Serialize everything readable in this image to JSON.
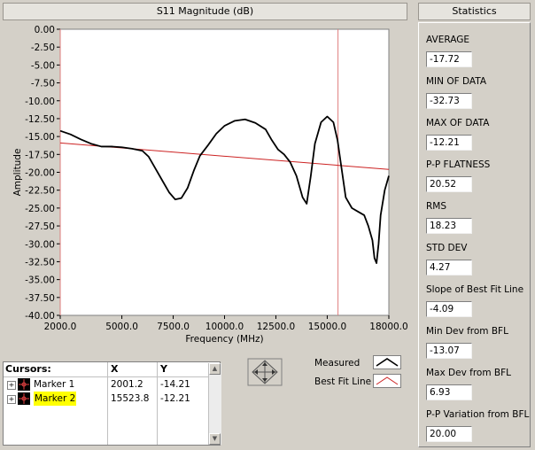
{
  "graph": {
    "title": "S11 Magnitude (dB)",
    "x_label": "Frequency (MHz)",
    "y_label": "Amplitude"
  },
  "stats": {
    "title": "Statistics",
    "items": [
      {
        "label": "AVERAGE",
        "value": "-17.72"
      },
      {
        "label": "MIN OF DATA",
        "value": "-32.73"
      },
      {
        "label": "MAX OF DATA",
        "value": "-12.21"
      },
      {
        "label": "P-P FLATNESS",
        "value": "20.52"
      },
      {
        "label": "RMS",
        "value": "18.23"
      },
      {
        "label": "STD DEV",
        "value": "4.27"
      },
      {
        "label": "Slope of Best Fit Line",
        "value": "-4.09"
      },
      {
        "label": "Min Dev from BFL",
        "value": "-13.07"
      },
      {
        "label": "Max Dev from BFL",
        "value": "6.93"
      },
      {
        "label": "P-P Variation from BFL",
        "value": "20.00"
      }
    ]
  },
  "cursors": {
    "header": "Cursors:",
    "col_x": "X",
    "col_y": "Y",
    "rows": [
      {
        "name": "Marker 1",
        "x": "2001.2",
        "y": "-14.21",
        "highlight": false
      },
      {
        "name": "Marker 2",
        "x": "15523.8",
        "y": "-12.21",
        "highlight": true
      }
    ]
  },
  "legend": {
    "items": [
      {
        "label": "Measured",
        "color": "#000000"
      },
      {
        "label": "Best Fit Line",
        "color": "#cc0000"
      }
    ]
  },
  "colors": {
    "plot_bg": "#ffffff",
    "measured": "#000000",
    "bestfit": "#cc2222",
    "cursor": "#e08080",
    "grid": "#cccccc",
    "highlight": "#ffff00"
  },
  "chart_data": {
    "type": "line",
    "title": "S11 Magnitude (dB)",
    "xlabel": "Frequency (MHz)",
    "ylabel": "Amplitude",
    "xlim": [
      2000,
      18000
    ],
    "ylim": [
      -40,
      0
    ],
    "x_ticks": [
      "2000.0",
      "5000.0",
      "7500.0",
      "10000.0",
      "12500.0",
      "15000.0",
      "18000.0"
    ],
    "x_tick_values": [
      2000,
      5000,
      7500,
      10000,
      12500,
      15000,
      18000
    ],
    "y_ticks": [
      "0.00",
      "-2.50",
      "-5.00",
      "-7.50",
      "-10.00",
      "-12.50",
      "-15.00",
      "-17.50",
      "-20.00",
      "-22.50",
      "-25.00",
      "-27.50",
      "-30.00",
      "-32.50",
      "-35.00",
      "-37.50",
      "-40.00"
    ],
    "y_tick_values": [
      0,
      -2.5,
      -5,
      -7.5,
      -10,
      -12.5,
      -15,
      -17.5,
      -20,
      -22.5,
      -25,
      -27.5,
      -30,
      -32.5,
      -35,
      -37.5,
      -40
    ],
    "grid": true,
    "series": [
      {
        "name": "Measured",
        "x": [
          2000,
          2500,
          3000,
          3500,
          4000,
          4500,
          5000,
          5500,
          6000,
          6300,
          6600,
          7000,
          7300,
          7600,
          7900,
          8200,
          8500,
          8800,
          9200,
          9600,
          10000,
          10500,
          11000,
          11500,
          12000,
          12300,
          12600,
          12900,
          13200,
          13500,
          13800,
          14000,
          14200,
          14400,
          14700,
          15000,
          15300,
          15500,
          15700,
          15900,
          16200,
          16500,
          16800,
          17000,
          17200,
          17300,
          17400,
          17500,
          17600,
          17800,
          18000
        ],
        "y": [
          -14.2,
          -14.7,
          -15.4,
          -16.0,
          -16.4,
          -16.4,
          -16.5,
          -16.7,
          -17.0,
          -17.8,
          -19.3,
          -21.3,
          -22.8,
          -23.8,
          -23.6,
          -22.2,
          -19.8,
          -17.7,
          -16.2,
          -14.6,
          -13.5,
          -12.8,
          -12.6,
          -13.1,
          -14.0,
          -15.5,
          -16.8,
          -17.5,
          -18.6,
          -20.5,
          -23.5,
          -24.4,
          -20.5,
          -16.0,
          -13.0,
          -12.2,
          -13.0,
          -15.5,
          -19.5,
          -23.5,
          -25.0,
          -25.5,
          -26.0,
          -27.5,
          -29.5,
          -32.0,
          -32.7,
          -30.0,
          -26.0,
          -22.5,
          -20.5
        ]
      },
      {
        "name": "Best Fit Line",
        "x": [
          2000,
          18000
        ],
        "y": [
          -15.9,
          -19.6
        ]
      }
    ],
    "cursor_x": 15523.8
  }
}
